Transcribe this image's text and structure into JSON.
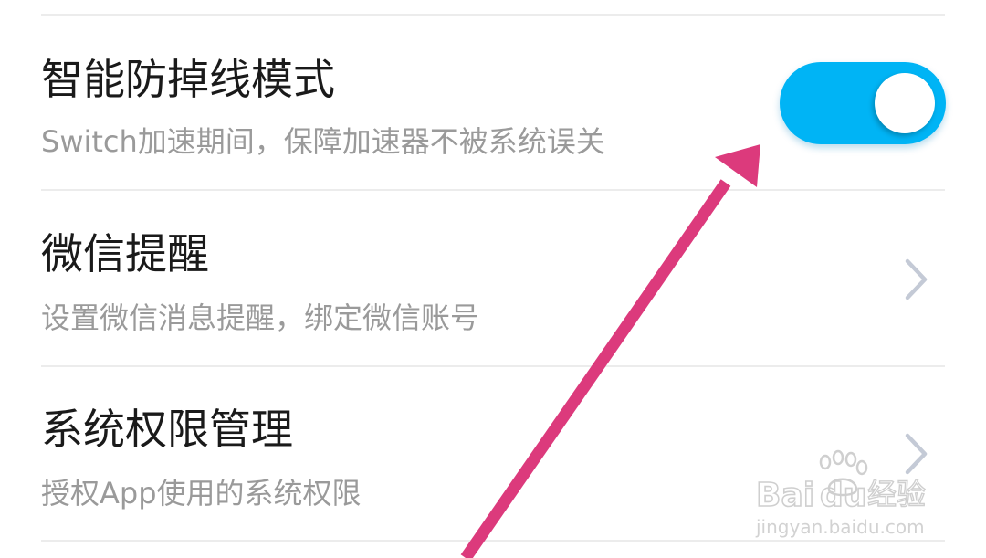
{
  "settings": {
    "items": [
      {
        "title": "智能防掉线模式",
        "subtitle": "Switch加速期间，保障加速器不被系统误关",
        "control": "toggle",
        "toggle_on": true
      },
      {
        "title": "微信提醒",
        "subtitle": "设置微信消息提醒，绑定微信账号",
        "control": "chevron-right-icon"
      },
      {
        "title": "系统权限管理",
        "subtitle": "授权App使用的系统权限",
        "control": "chevron-right-icon"
      }
    ]
  },
  "watermark": {
    "brand": "Baidu经验",
    "url": "jingyan.baidu.com"
  },
  "colors": {
    "toggle_on": "#00b4f5",
    "annotation_arrow": "#dc3a7c",
    "chevron": "#c4cad6",
    "divider": "#ececec"
  }
}
